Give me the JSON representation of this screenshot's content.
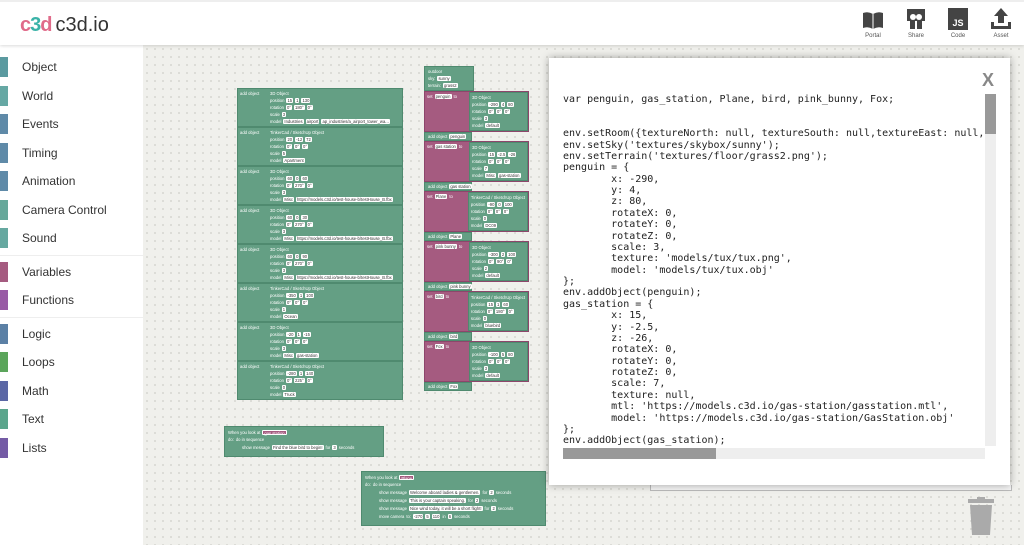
{
  "header": {
    "logo_mark": "c3d",
    "logo_text": "c3d.io",
    "tools": [
      {
        "label": "Portal",
        "icon": "book-icon"
      },
      {
        "label": "Share",
        "icon": "share-icon"
      },
      {
        "label": "Code",
        "icon": "js-icon",
        "glyph": "JS"
      },
      {
        "label": "Asset",
        "icon": "upload-icon"
      }
    ]
  },
  "sidebar": {
    "groups": [
      [
        {
          "label": "Object",
          "color": "#5b9aa0"
        },
        {
          "label": "World",
          "color": "#66a8a4"
        },
        {
          "label": "Events",
          "color": "#5f8aa8"
        },
        {
          "label": "Timing",
          "color": "#5f8aa8"
        },
        {
          "label": "Animation",
          "color": "#5f8aa8"
        },
        {
          "label": "Camera Control",
          "color": "#66a89a"
        },
        {
          "label": "Sound",
          "color": "#66a8a0"
        }
      ],
      [
        {
          "label": "Variables",
          "color": "#a55b80"
        },
        {
          "label": "Functions",
          "color": "#995ba5"
        }
      ],
      [
        {
          "label": "Logic",
          "color": "#5b80a5"
        },
        {
          "label": "Loops",
          "color": "#5ba55b"
        },
        {
          "label": "Math",
          "color": "#5b67a5"
        },
        {
          "label": "Text",
          "color": "#5ba58c"
        },
        {
          "label": "Lists",
          "color": "#745ba5"
        }
      ]
    ]
  },
  "blocks": {
    "left": [
      {
        "lab": "add object",
        "kind": "3D Object",
        "pos": [
          "15",
          "1",
          "130"
        ],
        "rot": [
          "0°",
          "180°",
          "0°"
        ],
        "scale": "3",
        "model": [
          "Industries",
          "airport",
          "ap_industries/a_airport_tower_wa..."
        ]
      },
      {
        "lab": "add object",
        "kind": "TinkerCad / SketchUp Object",
        "pos": [
          "20",
          "-12",
          "72"
        ],
        "rot": [
          "0°",
          "0°",
          "0°"
        ],
        "scale": "5",
        "model": [
          "Apartment"
        ]
      },
      {
        "lab": "add object",
        "kind": "3D Object",
        "pos": [
          "60",
          "0",
          "60"
        ],
        "rot": [
          "0°",
          "270°",
          "0°"
        ],
        "scale": "3",
        "model": [
          "Misc",
          "https://models.c3d.io/test-house-b/testHouse_B.fbx"
        ]
      },
      {
        "lab": "add object",
        "kind": "3D Object",
        "pos": [
          "60",
          "0",
          "30"
        ],
        "rot": [
          "0°",
          "270°",
          "0°"
        ],
        "scale": "3",
        "model": [
          "Misc",
          "https://models.c3d.io/test-house-b/testHouse_B.fbx"
        ]
      },
      {
        "lab": "add object",
        "kind": "3D Object",
        "pos": [
          "60",
          "0",
          "90"
        ],
        "rot": [
          "0°",
          "270°",
          "0°"
        ],
        "scale": "3",
        "model": [
          "Misc",
          "https://models.c3d.io/test-house-b/testHouse_B.fbx"
        ]
      },
      {
        "lab": "add object",
        "kind": "TinkerCad / SketchUp Object",
        "pos": [
          "-350",
          "1",
          "100"
        ],
        "rot": [
          "0°",
          "0°",
          "0°"
        ],
        "scale": "1",
        "model": [
          "Ocean"
        ]
      },
      {
        "lab": "add object",
        "kind": "3D Object",
        "pos": [
          "-20",
          "1",
          "-15"
        ],
        "rot": [
          "0°",
          "0°",
          "0°"
        ],
        "scale": "3",
        "model": [
          "Misc",
          "gas-station"
        ]
      },
      {
        "lab": "add object",
        "kind": "TinkerCad / SketchUp Object",
        "pos": [
          "-280",
          "1",
          "140"
        ],
        "rot": [
          "0°",
          "225°",
          "0°"
        ],
        "scale": "0",
        "model": [
          "Truck"
        ]
      }
    ],
    "world": {
      "title": "outdoor",
      "sky_label": "sky:",
      "sky": "sunny",
      "terrain_label": "terrain:",
      "terrain": "grass2"
    },
    "middle": [
      {
        "var": "penguin",
        "kind": "3D Object",
        "pos": [
          "-290",
          "4",
          "80"
        ],
        "rot": [
          "0°",
          "0°",
          "0°"
        ],
        "scale": "3",
        "model": [
          "default"
        ]
      },
      {
        "var": "gas station",
        "kind": "3D Object",
        "pos": [
          "15",
          "-2.5",
          "-26"
        ],
        "rot": [
          "0°",
          "0°",
          "0°"
        ],
        "scale": "7",
        "model": [
          "Misc",
          "gas-station"
        ]
      },
      {
        "var": "Plane",
        "kind": "TinkerCad / SketchUp Object",
        "pos": [
          "-90",
          "0",
          "100"
        ],
        "rot": [
          "0°",
          "0°",
          "0°"
        ],
        "scale": "0",
        "model": [
          "DC09"
        ]
      },
      {
        "var": "pink bunny",
        "kind": "3D Object",
        "pos": [
          "-300",
          "2",
          "100"
        ],
        "rot": [
          "0°",
          "90°",
          "0°"
        ],
        "scale": "2",
        "model": [
          "default"
        ]
      },
      {
        "var": "bird",
        "kind": "TinkerCad / SketchUp Object",
        "pos": [
          "15",
          "1",
          "60"
        ],
        "rot": [
          "0°",
          "180°",
          "0°"
        ],
        "scale": "0",
        "model": [
          "bluebird"
        ]
      },
      {
        "var": "Fox",
        "kind": "3D Object",
        "pos": [
          "-100",
          "5",
          "80"
        ],
        "rot": [
          "0°",
          "0°",
          "0°"
        ],
        "scale": "3",
        "model": [
          "default"
        ]
      }
    ],
    "labels": {
      "set": "set",
      "to": "to",
      "add": "add object",
      "position": "position",
      "rotation": "rotation",
      "scale": "scale",
      "model": "model",
      "when": "When you look at",
      "do": "do:",
      "seq": "do in sequence",
      "show": "show message",
      "for": "for",
      "seconds": "seconds",
      "move": "move camera",
      "move_to": "to:",
      "in": "in"
    },
    "event1": {
      "target": "gas station",
      "messages": [
        {
          "text": "Find the blue bird to begin!",
          "secs": "3"
        }
      ]
    },
    "event2": {
      "target": "Plane",
      "messages": [
        {
          "text": "Welcome aboard ladies & gentlemen.",
          "secs": "2"
        },
        {
          "text": "This is your captain speaking.",
          "secs": "2"
        },
        {
          "text": "Nice wind today, it will be a short flight!",
          "secs": "2"
        }
      ],
      "camera": [
        "-270",
        "5",
        "110"
      ],
      "camera_secs": "6"
    }
  },
  "modal": {
    "close": "X",
    "code": "var penguin, gas_station, Plane, bird, pink_bunny, Fox;\n\n\nenv.setRoom({textureNorth: null, textureSouth: null,textureEast: null, textureWest: null});\nenv.setSky('textures/skybox/sunny');\nenv.setTerrain('textures/floor/grass2.png');\npenguin = {\n        x: -290,\n        y: 4,\n        z: 80,\n        rotateX: 0,\n        rotateY: 0,\n        rotateZ: 0,\n        scale: 3,\n        texture: 'models/tux/tux.png',\n        model: 'models/tux/tux.obj'\n};\nenv.addObject(penguin);\ngas_station = {\n        x: 15,\n        y: -2.5,\n        z: -26,\n        rotateX: 0,\n        rotateY: 0,\n        rotateZ: 0,\n        scale: 7,\n        texture: null,\n        mtl: 'https://models.c3d.io/gas-station/gasstation.mtl',\n        model: 'https://models.c3d.io/gas-station/GasStation.obj'\n};\nenv.addObject(gas_station);",
    "vertical_scroll_fraction": 0.0,
    "horizontal_scroll_visible_fraction": 0.36
  }
}
